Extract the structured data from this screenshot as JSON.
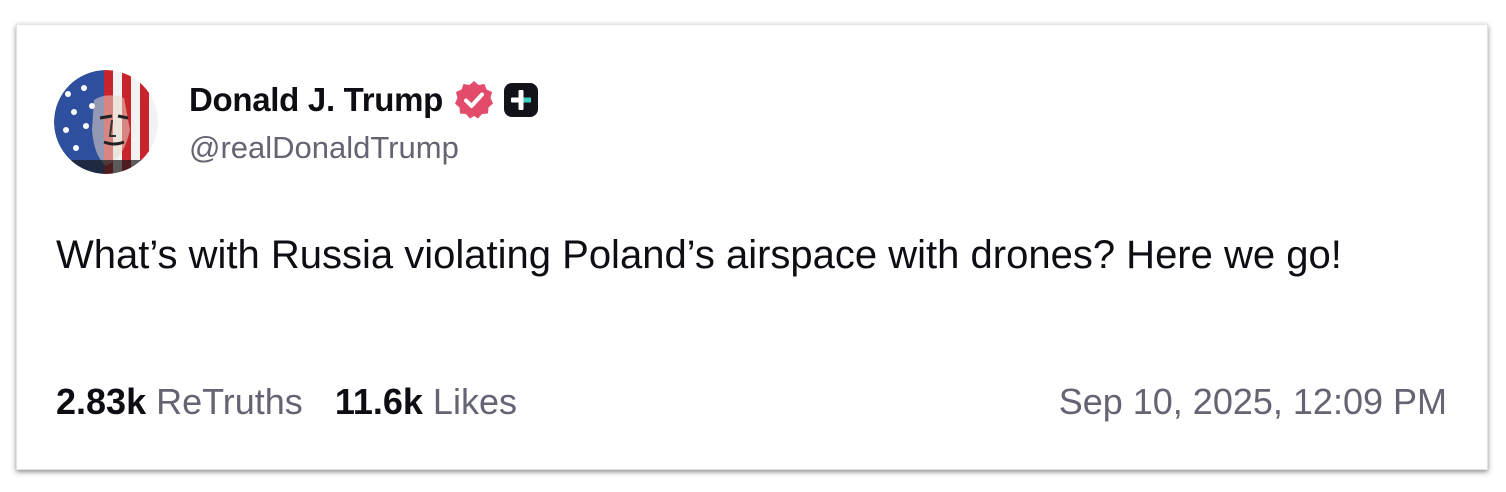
{
  "post": {
    "author": {
      "display_name": "Donald J. Trump",
      "handle": "@realDonaldTrump",
      "verified_icon": "verified-badge-icon",
      "badge_icon": "plus-badge-icon",
      "verified_color": "#e34b6b"
    },
    "text": "What’s with Russia violating Poland’s airspace with drones? Here we go!",
    "stats": {
      "retruths_count": "2.83k",
      "retruths_label": "ReTruths",
      "likes_count": "11.6k",
      "likes_label": "Likes"
    },
    "timestamp": "Sep 10, 2025, 12:09 PM"
  }
}
